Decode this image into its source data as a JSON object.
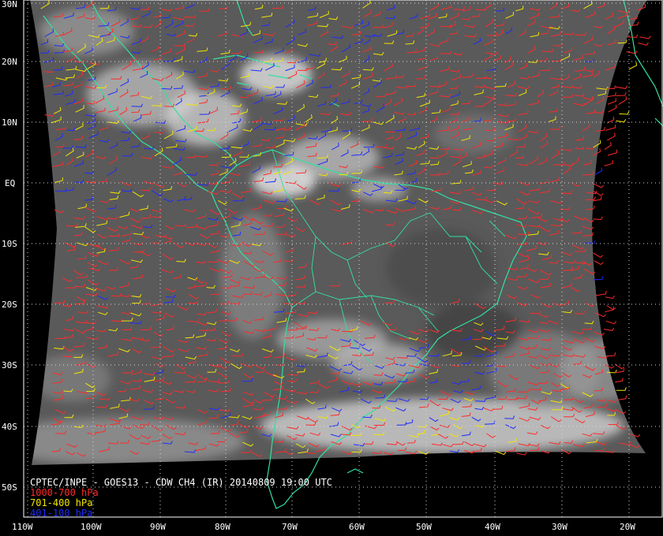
{
  "caption": "CPTEC/INPE - GOES13 - CDW CH4 (IR) 20140809 19:00 UTC",
  "legend": [
    {
      "label": "1000-700 hPa",
      "color": "#ff2a2a"
    },
    {
      "label": "701-400 hPa",
      "color": "#f2e600"
    },
    {
      "label": "401-100 hPa",
      "color": "#1f2bff"
    }
  ],
  "lat_labels": [
    "30N",
    "20N",
    "10N",
    "EQ",
    "10S",
    "20S",
    "30S",
    "40S",
    "50S"
  ],
  "lon_labels": [
    "110W",
    "100W",
    "90W",
    "80W",
    "70W",
    "60W",
    "50W",
    "40W",
    "30W",
    "20W"
  ],
  "colors": {
    "coast": "#33e0a0",
    "grid": "#d8d8d8",
    "background": "#000000",
    "imagery": "#5c5c5c"
  }
}
